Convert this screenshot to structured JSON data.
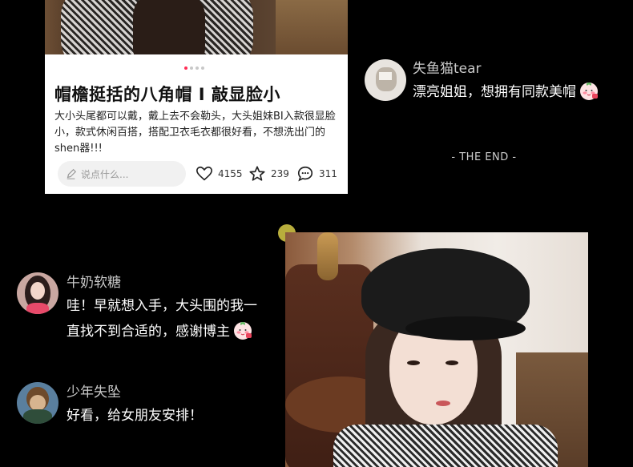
{
  "post": {
    "title": "帽檐挺括的八角帽 I 敲显脸小",
    "body": "大小头尾都可以戴，戴上去不会勒头，大头姐妹BI入款很显脸小，款式休闲百搭，搭配卫衣毛衣都很好看，不想洗出门的shen器!!!",
    "comment_placeholder": "说点什么...",
    "likes": "4155",
    "stars": "239",
    "comments": "311"
  },
  "comments": [
    {
      "username": "失鱼猫tear",
      "text": "漂亮姐姐，想拥有同款美帽",
      "emoji": "shy-peach-emoji"
    },
    {
      "username": "牛奶软糖",
      "text_line1": "哇！早就想入手，大头围的我一",
      "text_line2": "直找不到合适的，感谢博主",
      "emoji": "shy-peach-emoji"
    },
    {
      "username": "少年失坠",
      "text": "好看，给女朋友安排！"
    }
  ],
  "the_end": "- THE END -",
  "colors": {
    "background": "#000000",
    "accent_dot": "#ff2d55",
    "yellow_dot": "#b8ad3c"
  }
}
